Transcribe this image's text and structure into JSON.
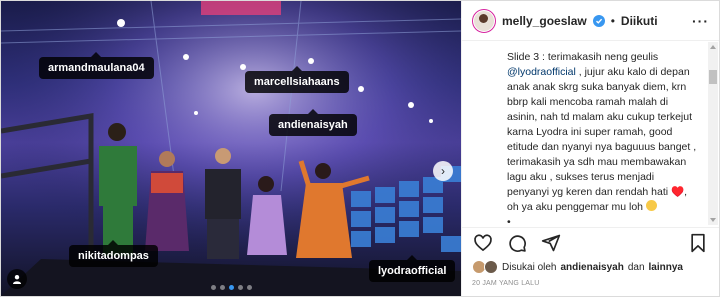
{
  "post": {
    "username": "melly_goeslaw",
    "separator": "•",
    "follow_status": "Diikuti",
    "more_icon": "more-horizontal-icon"
  },
  "photo": {
    "tags": [
      {
        "id": "armandmaulana04",
        "label": "armandmaulana04"
      },
      {
        "id": "marcellsiahaans",
        "label": "marcellsiahaans"
      },
      {
        "id": "andienaisyah",
        "label": "andienaisyah"
      },
      {
        "id": "nikitadompas",
        "label": "nikitadompas"
      },
      {
        "id": "lyodraofficial",
        "label": "lyodraofficial"
      }
    ],
    "carousel": {
      "total": 5,
      "active_index": 2
    }
  },
  "caption": {
    "part1": "Slide 3 : terimakasih neng geulis ",
    "mention": "@lyodraofficial",
    "part2": " , jujur aku kalo di depan anak anak skrg suka banyak diem, krn bbrp kali mencoba ramah malah di asinin, nah td malam aku cukup terkejut karna Lyodra ini super ramah, good etitude dan nyanyi nya baguuus banget , terimakasih ya sdh mau membawakan lagu aku , sukses terus menjadi penyanyi yg keren dan rendah hati ♥️, oh ya aku penggemar mu loh",
    "trailing": "•"
  },
  "likes": {
    "prefix": "Disukai oleh",
    "user": "andienaisyah",
    "middle": "dan",
    "others": "lainnya"
  },
  "timestamp": "20 JAM YANG LALU",
  "colors": {
    "accent": "#3897f0",
    "mention": "#00376b",
    "muted": "#8e8e8e"
  }
}
